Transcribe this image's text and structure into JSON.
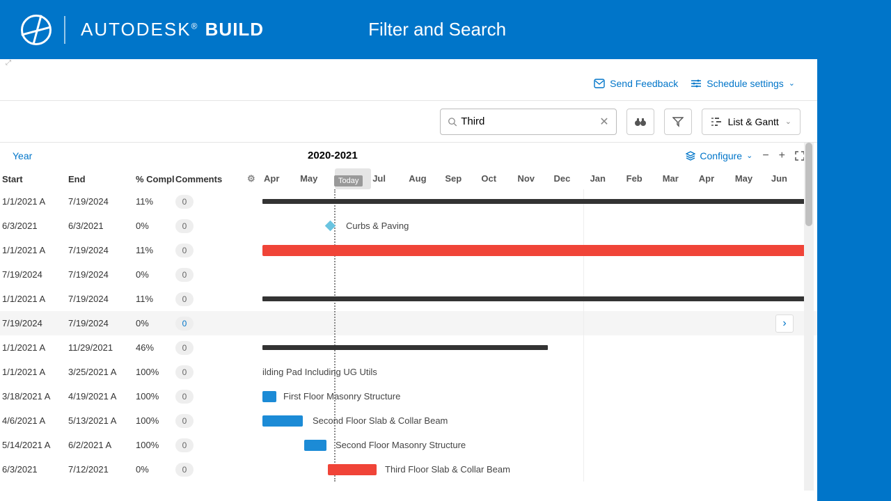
{
  "header": {
    "brand1": "AUTODESK",
    "brand2": "BUILD",
    "title": "Filter and Search"
  },
  "toolbar": {
    "feedback": "Send Feedback",
    "settings": "Schedule settings",
    "search_value": "Third",
    "view_mode": "List & Gantt"
  },
  "timeline": {
    "year_label": "Year",
    "range": "2020-2021",
    "configure": "Configure",
    "today": "Today",
    "months": [
      "Apr",
      "May",
      "Jun",
      "Jul",
      "Aug",
      "Sep",
      "Oct",
      "Nov",
      "Dec",
      "Jan",
      "Feb",
      "Mar",
      "Apr",
      "May",
      "Jun"
    ]
  },
  "columns": {
    "start": "Start",
    "end": "End",
    "compl": "% Compl",
    "comments": "Comments"
  },
  "rows": [
    {
      "start": "1/1/2021 A",
      "end": "7/19/2024",
      "compl": "11%",
      "comments": "0"
    },
    {
      "start": "6/3/2021",
      "end": "6/3/2021",
      "compl": "0%",
      "comments": "0"
    },
    {
      "start": "1/1/2021 A",
      "end": "7/19/2024",
      "compl": "11%",
      "comments": "0"
    },
    {
      "start": "7/19/2024",
      "end": "7/19/2024",
      "compl": "0%",
      "comments": "0"
    },
    {
      "start": "1/1/2021 A",
      "end": "7/19/2024",
      "compl": "11%",
      "comments": "0"
    },
    {
      "start": "7/19/2024",
      "end": "7/19/2024",
      "compl": "0%",
      "comments": "0"
    },
    {
      "start": "1/1/2021 A",
      "end": "11/29/2021",
      "compl": "46%",
      "comments": "0"
    },
    {
      "start": "1/1/2021 A",
      "end": "3/25/2021 A",
      "compl": "100%",
      "comments": "0"
    },
    {
      "start": "3/18/2021 A",
      "end": "4/19/2021 A",
      "compl": "100%",
      "comments": "0"
    },
    {
      "start": "4/6/2021 A",
      "end": "5/13/2021 A",
      "compl": "100%",
      "comments": "0"
    },
    {
      "start": "5/14/2021 A",
      "end": "6/2/2021 A",
      "compl": "100%",
      "comments": "0"
    },
    {
      "start": "6/3/2021",
      "end": "7/12/2021",
      "compl": "0%",
      "comments": "0"
    }
  ],
  "bars": {
    "curbs": "Curbs & Paving",
    "pad": "ilding Pad Including UG Utils",
    "first_masonry": "First Floor Masonry Structure",
    "second_slab": "Second Floor Slab & Collar Beam",
    "second_masonry": "Second Floor Masonry Structure",
    "third_slab": "Third Floor Slab & Collar Beam"
  }
}
